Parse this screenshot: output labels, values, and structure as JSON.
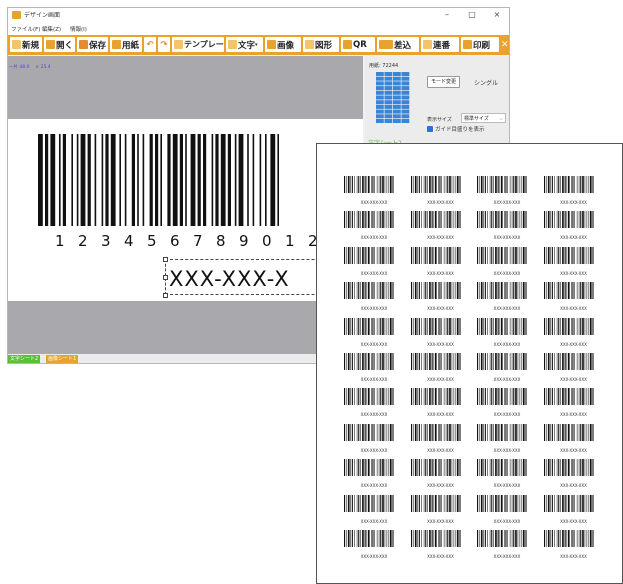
{
  "window": {
    "title": "デザイン画面",
    "controls": [
      "–",
      "□",
      "×"
    ]
  },
  "menu": [
    "ファイル(F)",
    "編集(Z)",
    "情報(I)"
  ],
  "toolbar": {
    "new": "新規",
    "open": "開く",
    "save": "保存",
    "paper": "用紙",
    "undo": "↶",
    "redo": "↷",
    "template": "テンプレート",
    "text": "文字",
    "image": "画像",
    "shape": "図形",
    "qr": "QR",
    "merge": "差込",
    "serial": "連番",
    "print": "印刷",
    "close": "✕"
  },
  "canvas": {
    "coords": "一片 48.0 　× 25.4",
    "barcode_digits": [
      "1",
      "2",
      "3",
      "4",
      "5",
      "6",
      "7",
      "8",
      "9",
      "0",
      "1",
      "2"
    ],
    "barcode_bars": [
      3,
      1,
      2,
      1,
      3,
      2,
      1,
      1,
      2,
      3,
      1,
      2,
      1,
      1,
      3,
      1,
      2,
      2,
      1,
      3,
      1,
      1,
      2,
      1,
      3,
      2,
      1,
      2,
      1,
      3,
      2,
      1,
      1,
      2,
      1,
      3,
      2,
      1,
      2,
      1,
      1,
      3,
      2,
      1,
      3,
      1,
      2,
      1,
      1,
      2,
      3,
      1,
      2,
      1,
      2,
      3,
      1,
      1,
      2,
      1,
      3,
      1,
      2,
      2,
      1,
      1,
      3,
      2,
      1,
      2,
      1,
      3,
      1,
      2,
      1,
      2,
      3,
      1,
      1,
      2
    ],
    "big_text": "XXX-XXX-X"
  },
  "right_panel": {
    "paper_code": "用紙: 72244",
    "mode_button": "モード変更",
    "mode_value": "シングル",
    "size_label": "表示サイズ",
    "size_value": "標準サイズ",
    "guide_label": "ガイド目盛りを表示",
    "section_title": "文字シート2"
  },
  "sheet_tabs": [
    {
      "label": "文字シート2",
      "color": "#5bbf3a"
    },
    {
      "label": "画像シート1",
      "color": "#e8a32c"
    }
  ],
  "preview": {
    "label_text": "XXX-XXX-XXX",
    "columns": 4,
    "rows": 11
  },
  "colors": {
    "accent": "#e8a32c",
    "green": "#5bbf3a",
    "blue": "#2f6fd8",
    "canvas_gray": "#a9a9ad"
  }
}
